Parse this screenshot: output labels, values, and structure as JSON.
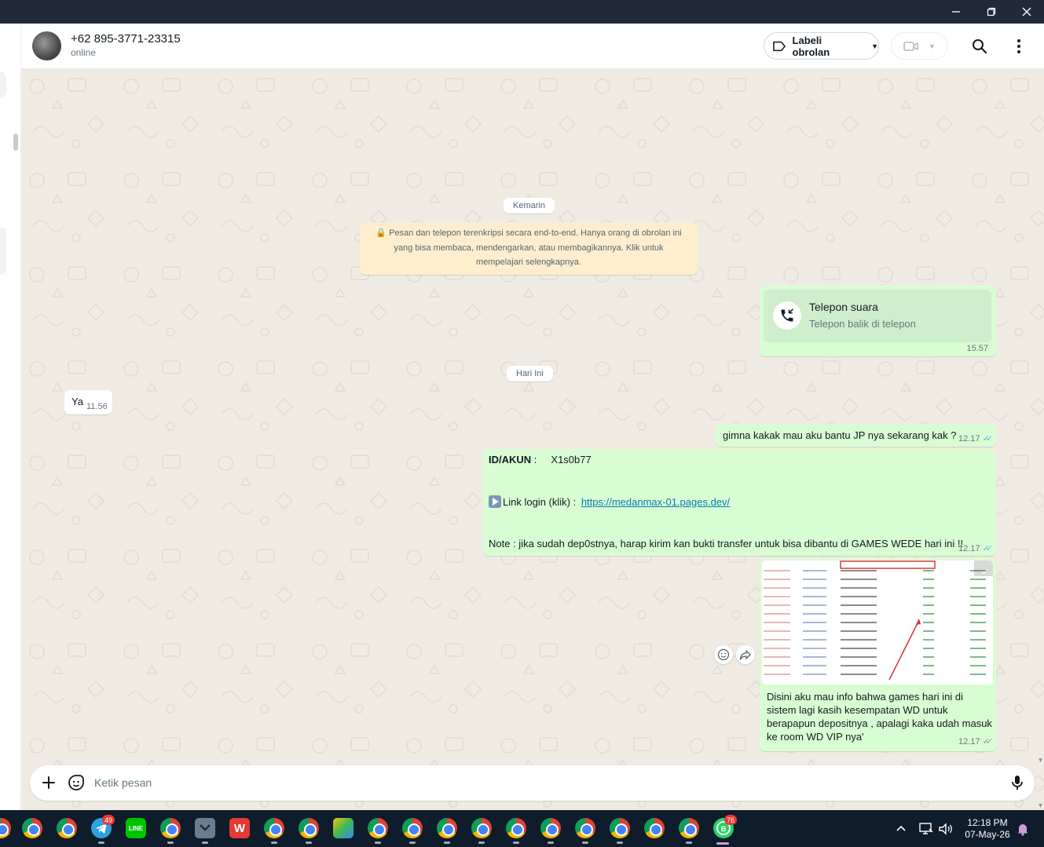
{
  "window": {
    "minimize_icon": "minimize-icon",
    "maximize_icon": "restore-icon",
    "close_icon": "close-icon"
  },
  "header": {
    "contact_name": "+62 895-3771-23315",
    "status": "online",
    "label_button": "Labeli obrolan",
    "icons": [
      "label-icon",
      "video-call-icon",
      "search-icon",
      "menu-icon"
    ]
  },
  "chat": {
    "date_yesterday": "Kemarin",
    "encryption_notice": "🔒 Pesan dan telepon terenkripsi secara end-to-end. Hanya orang di obrolan ini yang bisa membaca, mendengarkan, atau membagikannya. Klik untuk mempelajari selengkapnya.",
    "call": {
      "title": "Telepon suara",
      "subtitle": "Telepon balik di telepon",
      "time": "15.57"
    },
    "date_today": "Hari Ini",
    "incoming": {
      "text": "Ya",
      "time": "11.56"
    },
    "msg1": {
      "text": "gimna kakak mau aku bantu JP  nya sekarang kak ?",
      "time": "12.17"
    },
    "msg2": {
      "id_label": "ID/AKUN",
      "id_sep": " :",
      "id_value": "X1s0b77",
      "link_label": "Link login (klik) : ",
      "link_url": "https://medanmax-01.pages.dev/",
      "note": "Note : jika sudah dep0stnya, harap kirim kan bukti  transfer untuk bisa dibantu di GAMES WEDE hari ini !!",
      "time": "12.17"
    },
    "msg3": {
      "caption": "Disini aku mau info bahwa games hari ini di sistem lagi kasih kesempatan WD untuk berapapun depositnya , apalagi kaka udah masuk ke room WD VIP nya'",
      "time": "12.17"
    }
  },
  "composer": {
    "placeholder": "Ketik pesan"
  },
  "taskbar": {
    "telegram_badge": "49",
    "whatsapp_badge": "76",
    "clock_time": "12:18 PM",
    "clock_date": "07-May-26"
  },
  "colors": {
    "outgoing": "#d9fdd3",
    "incoming": "#ffffff",
    "chat_bg": "#efeae2",
    "read_ticks": "#53bdeb",
    "taskbar": "#0f1c2b"
  }
}
